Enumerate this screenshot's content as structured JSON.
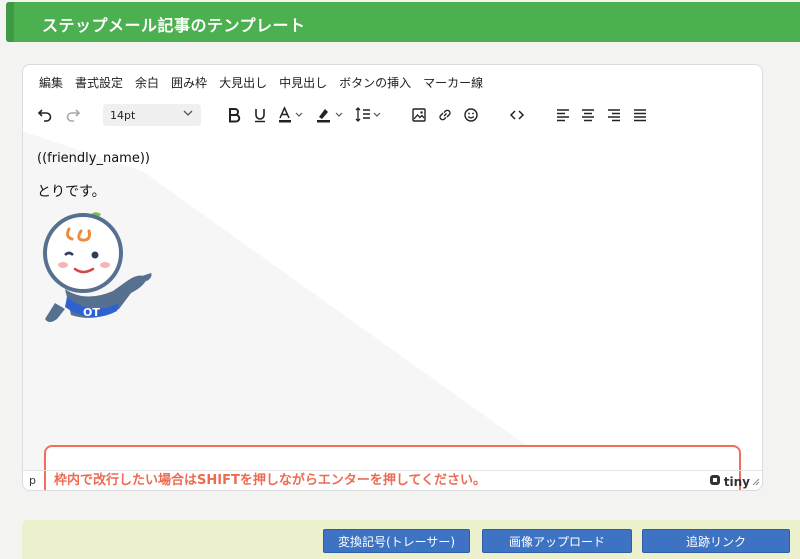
{
  "header": {
    "title": "ステップメール記事のテンプレート",
    "color": "#4caf50"
  },
  "editor": {
    "menubar": [
      "編集",
      "書式設定",
      "余白",
      "囲み枠",
      "大見出し",
      "中見出し",
      "ボタンの挿入",
      "マーカー線"
    ],
    "toolbar": {
      "font_size": "14pt",
      "icons": [
        "undo-icon",
        "redo-icon",
        "bold-icon",
        "underline-icon",
        "text-color-icon",
        "highlight-color-icon",
        "line-height-icon",
        "image-icon",
        "link-icon",
        "emoji-icon",
        "code-icon",
        "align-left-icon",
        "align-center-icon",
        "align-right-icon",
        "align-justify-icon"
      ]
    },
    "content": {
      "line1": "((friendly_name))",
      "line2": "とりです。",
      "mascot_sash": "OT",
      "notice": "枠内で改行したい場合はSHIFTを押しながらエンターを押してください。"
    },
    "statusbar": {
      "path": "p",
      "brand": "tiny"
    }
  },
  "footer": {
    "buttons": [
      "変換記号(トレーサー)",
      "画像アップロード",
      "追跡リンク"
    ]
  },
  "colors": {
    "accent": "#4caf50",
    "notice_border": "#f06e5b",
    "notice_text": "#ee6b52",
    "button": "#3e73c4",
    "footer_bg": "#ecf0cd"
  }
}
